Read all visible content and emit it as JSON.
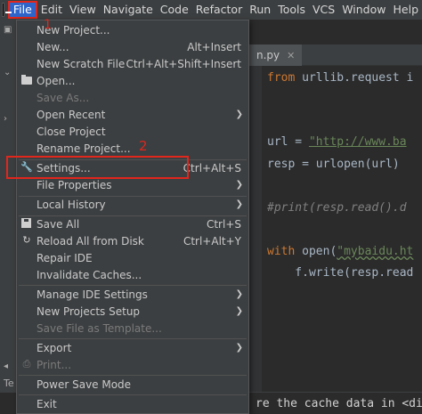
{
  "menubar": {
    "items": [
      "File",
      "Edit",
      "View",
      "Navigate",
      "Code",
      "Refactor",
      "Run",
      "Tools",
      "VCS",
      "Window",
      "Help"
    ],
    "active": "File"
  },
  "editor": {
    "tab_label": "n.py",
    "lines": {
      "l1a": "from",
      "l1b": " urllib.request i",
      "l2a": "url = ",
      "l2b": "\"http://www.ba",
      "l3": "resp = urlopen(url)",
      "l4": "#print(resp.read().d",
      "l5a": "with",
      "l5b": " open(",
      "l5c": "\"mybaidu.ht",
      "l6": "    f.write(resp.read"
    },
    "bottom_text": "re the cache data in <di",
    "left_label": "Te"
  },
  "file_menu": {
    "new_project": "New Project...",
    "new": "New...",
    "new_shortcut": "Alt+Insert",
    "new_scratch": "New Scratch File",
    "new_scratch_shortcut": "Ctrl+Alt+Shift+Insert",
    "open": "Open...",
    "save_as": "Save As...",
    "open_recent": "Open Recent",
    "close_project": "Close Project",
    "rename_project": "Rename Project...",
    "settings": "Settings...",
    "settings_shortcut": "Ctrl+Alt+S",
    "file_properties": "File Properties",
    "local_history": "Local History",
    "save_all": "Save All",
    "save_all_shortcut": "Ctrl+S",
    "reload": "Reload All from Disk",
    "reload_shortcut": "Ctrl+Alt+Y",
    "repair_ide": "Repair IDE",
    "invalidate_caches": "Invalidate Caches...",
    "manage_ide_settings": "Manage IDE Settings",
    "new_projects_setup": "New Projects Setup",
    "save_file_as_template": "Save File as Template...",
    "export": "Export",
    "print": "Print...",
    "power_save_mode": "Power Save Mode",
    "exit": "Exit"
  },
  "annotations": {
    "step1": "1",
    "step2": "2"
  }
}
